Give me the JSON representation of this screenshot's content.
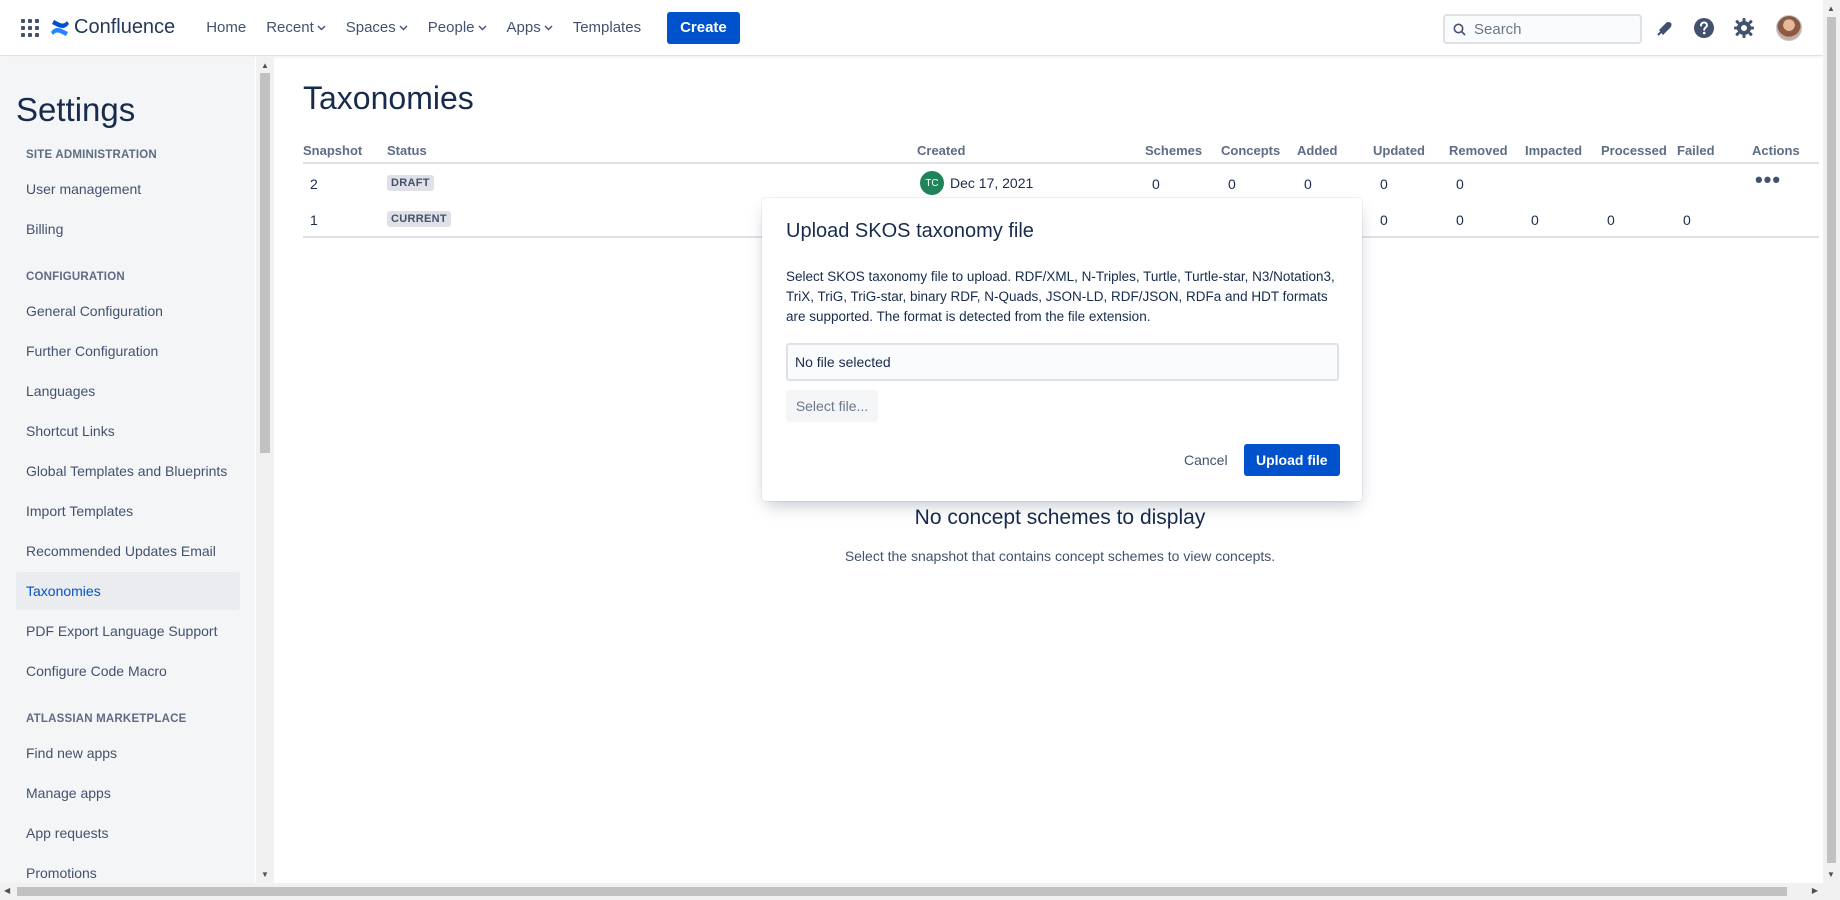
{
  "colors": {
    "brand": "#0052cc",
    "text": "#172b4d",
    "subtle": "#42526e",
    "sidebar_bg": "#f4f5f7",
    "avatar_green": "#1f845a"
  },
  "topnav": {
    "logo_text": "Confluence",
    "items": [
      {
        "label": "Home",
        "has_dropdown": false
      },
      {
        "label": "Recent",
        "has_dropdown": true
      },
      {
        "label": "Spaces",
        "has_dropdown": true
      },
      {
        "label": "People",
        "has_dropdown": true
      },
      {
        "label": "Apps",
        "has_dropdown": true
      },
      {
        "label": "Templates",
        "has_dropdown": false
      }
    ],
    "create_label": "Create",
    "search_placeholder": "Search",
    "icons": [
      "app-switcher-icon",
      "notifications-icon",
      "help-icon",
      "settings-icon",
      "profile-avatar"
    ]
  },
  "sidebar": {
    "title": "Settings",
    "sections": [
      {
        "heading": "SITE ADMINISTRATION",
        "items": [
          "User management",
          "Billing"
        ]
      },
      {
        "heading": "CONFIGURATION",
        "items": [
          "General Configuration",
          "Further Configuration",
          "Languages",
          "Shortcut Links",
          "Global Templates and Blueprints",
          "Import Templates",
          "Recommended Updates Email",
          "Taxonomies",
          "PDF Export Language Support",
          "Configure Code Macro"
        ]
      },
      {
        "heading": "ATLASSIAN MARKETPLACE",
        "items": [
          "Find new apps",
          "Manage apps",
          "App requests",
          "Promotions"
        ]
      }
    ],
    "active_item": "Taxonomies"
  },
  "main": {
    "title": "Taxonomies",
    "table": {
      "columns": [
        "Snapshot",
        "Status",
        "Created",
        "Schemes",
        "Concepts",
        "Added",
        "Updated",
        "Removed",
        "Impacted",
        "Processed",
        "Failed",
        "Actions"
      ],
      "rows": [
        {
          "snapshot": "2",
          "status": "DRAFT",
          "avatar": "TC",
          "created": "Dec 17, 2021",
          "schemes": "0",
          "concepts": "0",
          "added": "0",
          "updated": "0",
          "removed": "0",
          "impacted": "",
          "processed": "",
          "failed": "",
          "actions_icon": "more-icon"
        },
        {
          "snapshot": "1",
          "status": "CURRENT",
          "avatar": "",
          "created": "",
          "schemes": "",
          "concepts": "",
          "added": "",
          "updated": "0",
          "removed": "0",
          "impacted": "0",
          "processed": "0",
          "failed": "0",
          "actions_icon": ""
        }
      ]
    },
    "empty_title": "No concept schemes to display",
    "empty_sub": "Select the snapshot that contains concept schemes to view concepts."
  },
  "modal": {
    "title": "Upload SKOS taxonomy file",
    "description": "Select SKOS taxonomy file to upload. RDF/XML, N-Triples, Turtle, Turtle-star, N3/Notation3, TriX, TriG, TriG-star, binary RDF, N-Quads, JSON-LD, RDF/JSON, RDFa and HDT formats are supported. The format is detected from the file extension.",
    "file_value": "No file selected",
    "select_label": "Select file...",
    "cancel_label": "Cancel",
    "upload_label": "Upload file"
  }
}
